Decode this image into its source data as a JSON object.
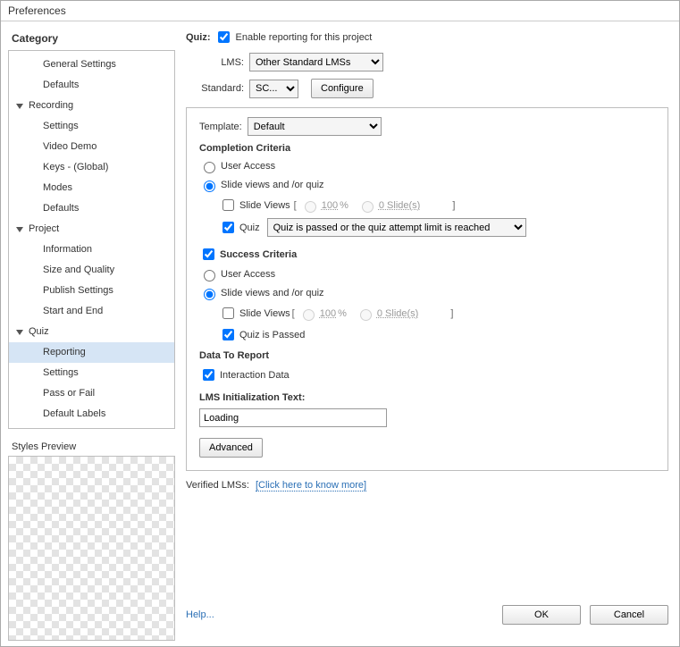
{
  "window": {
    "title": "Preferences"
  },
  "sidebar": {
    "header": "Category",
    "items": [
      {
        "label": "General Settings",
        "depth": 2
      },
      {
        "label": "Defaults",
        "depth": 2
      },
      {
        "label": "Recording",
        "depth": 1,
        "expandable": true
      },
      {
        "label": "Settings",
        "depth": 2
      },
      {
        "label": "Video Demo",
        "depth": 2
      },
      {
        "label": "Keys - (Global)",
        "depth": 2
      },
      {
        "label": "Modes",
        "depth": 2
      },
      {
        "label": "Defaults",
        "depth": 2
      },
      {
        "label": "Project",
        "depth": 1,
        "expandable": true
      },
      {
        "label": "Information",
        "depth": 2
      },
      {
        "label": "Size and Quality",
        "depth": 2
      },
      {
        "label": "Publish Settings",
        "depth": 2
      },
      {
        "label": "Start and End",
        "depth": 2
      },
      {
        "label": "Quiz",
        "depth": 1,
        "expandable": true
      },
      {
        "label": "Reporting",
        "depth": 2,
        "selected": true
      },
      {
        "label": "Settings",
        "depth": 2
      },
      {
        "label": "Pass or Fail",
        "depth": 2
      },
      {
        "label": "Default Labels",
        "depth": 2
      }
    ],
    "styles_header": "Styles Preview"
  },
  "main": {
    "quiz_label": "Quiz:",
    "enable_label": "Enable reporting for this project",
    "lms_label": "LMS:",
    "lms_value": "Other Standard LMSs",
    "standard_label": "Standard:",
    "standard_value": "SC...",
    "configure_button": "Configure",
    "template_label": "Template:",
    "template_value": "Default",
    "completion_header": "Completion Criteria",
    "user_access": "User Access",
    "slide_views_quiz": "Slide views and /or quiz",
    "slide_views": "Slide Views",
    "hundred_pct": "100",
    "pct_sym": "%",
    "zero_slides": "0 Slide(s)",
    "quiz": "Quiz",
    "quiz_dropdown": "Quiz is passed or the quiz attempt limit is reached",
    "success_header": "Success Criteria",
    "quiz_passed": "Quiz is Passed",
    "data_report_header": "Data To Report",
    "interaction_data": "Interaction Data",
    "lms_init_header": "LMS Initialization Text:",
    "lms_init_value": "Loading",
    "advanced_button": "Advanced",
    "verified_lms": "Verified LMSs:",
    "verified_link": "[Click here to know more]"
  },
  "footer": {
    "help": "Help...",
    "ok": "OK",
    "cancel": "Cancel"
  }
}
